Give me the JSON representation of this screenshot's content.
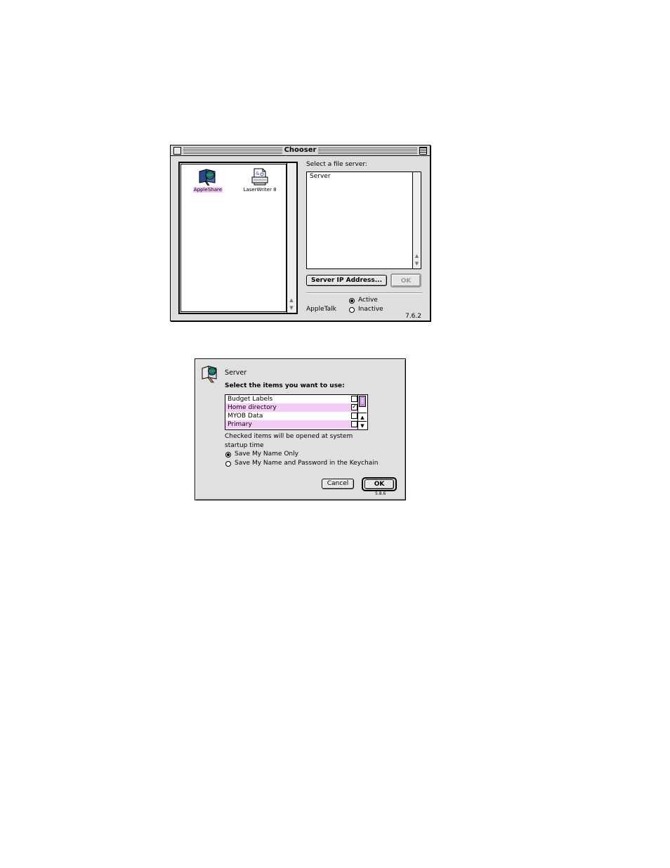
{
  "chooser": {
    "title": "Chooser",
    "devices": [
      {
        "label": "AppleShare",
        "icon": "appleshare-icon",
        "selected": true
      },
      {
        "label": "LaserWriter 8",
        "icon": "laserwriter-icon",
        "selected": false
      }
    ],
    "select_label": "Select a file server:",
    "servers": [
      "Server"
    ],
    "server_ip_button": "Server IP Address...",
    "ok_button": "OK",
    "appletalk_label": "AppleTalk",
    "appletalk_active": "Active",
    "appletalk_inactive": "Inactive",
    "appletalk_state": "Active",
    "version": "7.6.2"
  },
  "server_dialog": {
    "title": "Server",
    "prompt": "Select the items you want to use:",
    "items": [
      {
        "name": "Budget Labels",
        "checked": false,
        "highlighted": false
      },
      {
        "name": "Home directory",
        "checked": true,
        "highlighted": true
      },
      {
        "name": "MYOB Data",
        "checked": false,
        "highlighted": false
      },
      {
        "name": "Primary",
        "checked": false,
        "highlighted": true
      }
    ],
    "note_line1": "Checked items will be opened at system",
    "note_line2": "startup time",
    "option_name_only": "Save My Name Only",
    "option_keychain": "Save My Name and Password in the Keychain",
    "selected_option": "Save My Name Only",
    "cancel_button": "Cancel",
    "ok_button": "OK",
    "version": "5.8.6"
  },
  "colors": {
    "highlight": "#f5ccf5",
    "scroll_thumb": "#c08fd6",
    "window_bg": "#dedede"
  }
}
